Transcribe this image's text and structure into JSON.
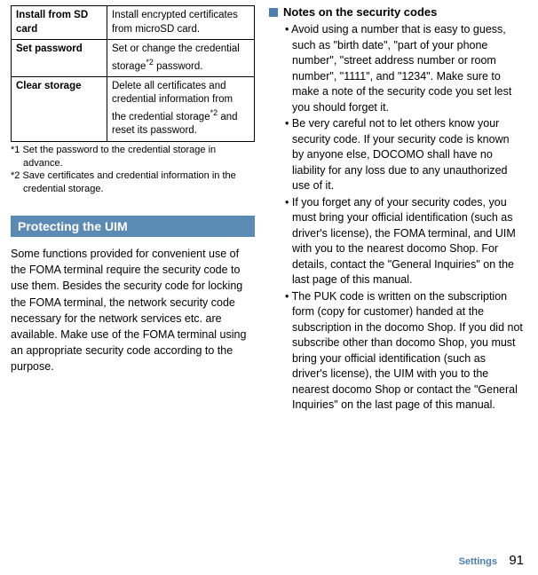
{
  "table": {
    "rows": [
      {
        "label": "Install from SD card",
        "desc": "Install encrypted certificates from microSD card."
      },
      {
        "label": "Set password",
        "desc_pre": "Set or change the credential storage",
        "desc_sup": "*2",
        "desc_post": " password."
      },
      {
        "label": "Clear storage",
        "desc_pre": "Delete all certificates and credential information from the credential storage",
        "desc_sup": "*2",
        "desc_post": " and reset its password."
      }
    ]
  },
  "footnotes": {
    "fn1": "*1 Set the password to the credential storage in advance.",
    "fn2": "*2 Save certificates and credential information in the credential storage."
  },
  "heading": "Protecting the UIM",
  "intro": "Some functions provided for convenient use of the FOMA terminal require the security code to use them. Besides the security code for locking the FOMA terminal, the network security code necessary for the network services etc. are available. Make use of the FOMA terminal using an appropriate security code according to the purpose.",
  "notes_title": "Notes on the security codes",
  "notes": [
    "Avoid using a number that is easy to guess, such as \"birth date\", \"part of your phone number\", \"street address number or room number\", \"1111\", and \"1234\". Make sure to make a note of the security code you set lest you should forget it.",
    "Be very careful not to let others know your security code. If your security code is known by anyone else, DOCOMO shall have no liability for any loss due to any unauthorized use of it.",
    "If you forget any of your security codes, you must bring your official identification (such as driver's license), the FOMA terminal, and UIM with you to the nearest docomo Shop. For details, contact the \"General Inquiries\" on the last page of this manual.",
    "The PUK code is written on the subscription form (copy for customer) handed at the subscription in the docomo Shop. If you did not subscribe other than docomo Shop, you must bring your official identification (such as driver's license), the UIM with you to the nearest docomo Shop or contact the \"General Inquiries\" on the last page of this manual."
  ],
  "footer": {
    "section": "Settings",
    "page": "91"
  }
}
